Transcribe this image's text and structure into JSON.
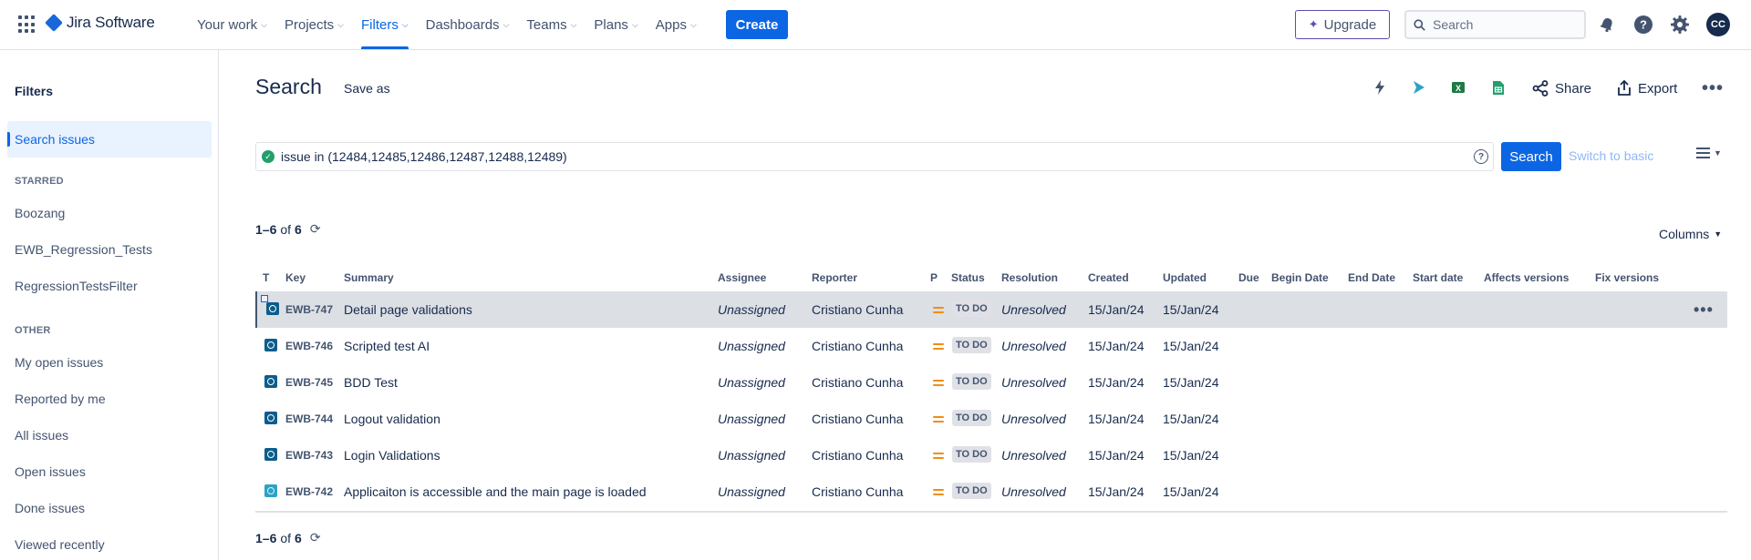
{
  "app": {
    "name": "Jira Software",
    "icon": "jira-logo-icon"
  },
  "nav": {
    "items": [
      {
        "label": "Your work",
        "active": false
      },
      {
        "label": "Projects",
        "active": false
      },
      {
        "label": "Filters",
        "active": true
      },
      {
        "label": "Dashboards",
        "active": false
      },
      {
        "label": "Teams",
        "active": false
      },
      {
        "label": "Plans",
        "active": false
      },
      {
        "label": "Apps",
        "active": false
      }
    ],
    "create_label": "Create",
    "upgrade_label": "Upgrade",
    "search_placeholder": "Search",
    "avatar_initials": "CC",
    "accent": "#0c66e4"
  },
  "sidebar": {
    "title": "Filters",
    "active_item": "Search issues",
    "starred_heading": "STARRED",
    "starred": [
      "Boozang",
      "EWB_Regression_Tests",
      "RegressionTestsFilter"
    ],
    "other_heading": "OTHER",
    "other": [
      "My open issues",
      "Reported by me",
      "All issues",
      "Open issues",
      "Done issues",
      "Viewed recently"
    ]
  },
  "main": {
    "title": "Search",
    "save_as": "Save as",
    "share_label": "Share",
    "export_label": "Export",
    "jql_query": "issue in (12484,12485,12486,12487,12488,12489)",
    "search_button": "Search",
    "switch_basic": "Switch to basic",
    "columns_label": "Columns",
    "count": {
      "range": "1–6",
      "of_text": "of",
      "total": "6"
    }
  },
  "table": {
    "headers": {
      "t": "T",
      "key": "Key",
      "summary": "Summary",
      "assignee": "Assignee",
      "reporter": "Reporter",
      "p": "P",
      "status": "Status",
      "resolution": "Resolution",
      "created": "Created",
      "updated": "Updated",
      "due": "Due",
      "begin_date": "Begin Date",
      "end_date": "End Date",
      "start_date": "Start date",
      "affects_versions": "Affects versions",
      "fix_versions": "Fix versions"
    },
    "rows": [
      {
        "key": "EWB-747",
        "summary": "Detail page validations",
        "assignee": "Unassigned",
        "reporter": "Cristiano Cunha",
        "status": "TO DO",
        "resolution": "Unresolved",
        "created": "15/Jan/24",
        "updated": "15/Jan/24"
      },
      {
        "key": "EWB-746",
        "summary": "Scripted test AI",
        "assignee": "Unassigned",
        "reporter": "Cristiano Cunha",
        "status": "TO DO",
        "resolution": "Unresolved",
        "created": "15/Jan/24",
        "updated": "15/Jan/24"
      },
      {
        "key": "EWB-745",
        "summary": "BDD Test",
        "assignee": "Unassigned",
        "reporter": "Cristiano Cunha",
        "status": "TO DO",
        "resolution": "Unresolved",
        "created": "15/Jan/24",
        "updated": "15/Jan/24"
      },
      {
        "key": "EWB-744",
        "summary": "Logout validation",
        "assignee": "Unassigned",
        "reporter": "Cristiano Cunha",
        "status": "TO DO",
        "resolution": "Unresolved",
        "created": "15/Jan/24",
        "updated": "15/Jan/24"
      },
      {
        "key": "EWB-743",
        "summary": "Login Validations",
        "assignee": "Unassigned",
        "reporter": "Cristiano Cunha",
        "status": "TO DO",
        "resolution": "Unresolved",
        "created": "15/Jan/24",
        "updated": "15/Jan/24"
      },
      {
        "key": "EWB-742",
        "summary": "Applicaiton is accessible and the main page is loaded",
        "assignee": "Unassigned",
        "reporter": "Cristiano Cunha",
        "status": "TO DO",
        "resolution": "Unresolved",
        "created": "15/Jan/24",
        "updated": "15/Jan/24"
      }
    ]
  }
}
